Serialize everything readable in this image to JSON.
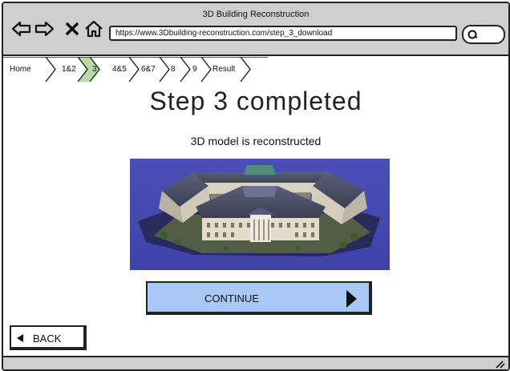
{
  "window": {
    "title": "3D Building Reconstruction"
  },
  "browser": {
    "url": "https://www.3Dbuilding-reconstruction.com/step_3_download",
    "nav_icons": [
      "back-arrow-icon",
      "forward-arrow-icon",
      "close-icon",
      "home-icon"
    ],
    "search_icon": "search-icon"
  },
  "breadcrumb": {
    "items": [
      {
        "label": "Home",
        "active": false
      },
      {
        "label": "1&2",
        "active": false
      },
      {
        "label": "3",
        "active": true
      },
      {
        "label": "4&5",
        "active": false
      },
      {
        "label": "6&7",
        "active": false
      },
      {
        "label": "8",
        "active": false
      },
      {
        "label": "9",
        "active": false
      },
      {
        "label": "Result",
        "active": false
      }
    ],
    "active_color": "#b5dba8"
  },
  "main": {
    "heading": "Step 3 completed",
    "subheading": "3D model is reconstructed",
    "image_alt": "3D reconstructed building model"
  },
  "buttons": {
    "continue_label": "CONTINUE",
    "continue_color": "#a8c8f5",
    "back_label": "BACK"
  }
}
